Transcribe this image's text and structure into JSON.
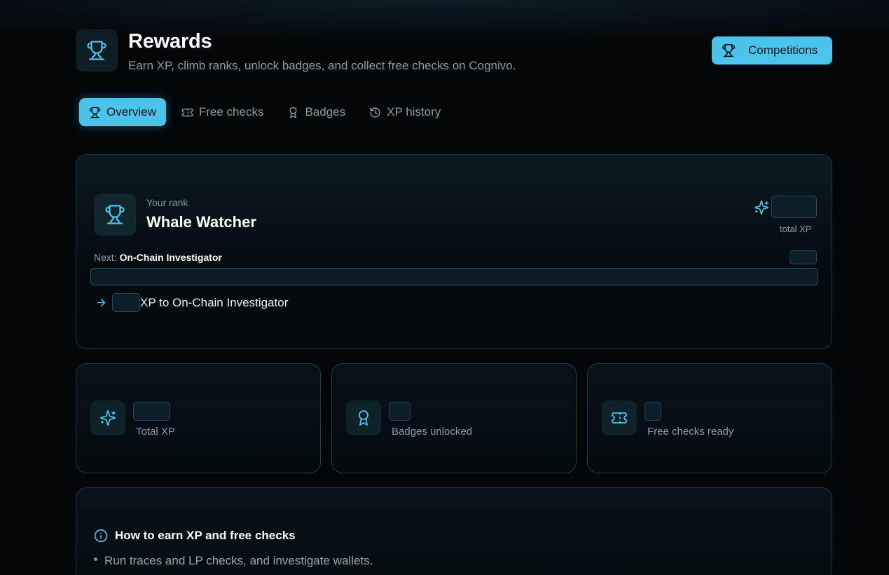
{
  "colors": {
    "accent": "#4cc3ea",
    "background": "#03070a",
    "card_border": "#1d3a45"
  },
  "header": {
    "icon": "trophy-icon",
    "title": "Rewards",
    "subtitle": "Earn XP, climb ranks, unlock badges, and collect free checks on Cognivo.",
    "competitions_label": "Competitions"
  },
  "tabs": [
    {
      "label": "Overview",
      "icon": "trophy-icon",
      "active": true
    },
    {
      "label": "Free checks",
      "icon": "ticket-icon",
      "active": false
    },
    {
      "label": "Badges",
      "icon": "award-icon",
      "active": false
    },
    {
      "label": "XP history",
      "icon": "history-icon",
      "active": false
    }
  ],
  "rank": {
    "label": "Your rank",
    "name": "Whale Watcher",
    "total_xp_label": "total XP",
    "next_prefix": "Next:",
    "next_name": "On-Chain Investigator",
    "to_next_suffix": "XP to On-Chain Investigator"
  },
  "stats": [
    {
      "label": "Total XP",
      "icon": "sparkles-icon"
    },
    {
      "label": "Badges unlocked",
      "icon": "award-icon"
    },
    {
      "label": "Free checks ready",
      "icon": "ticket-icon"
    }
  ],
  "info": {
    "title": "How to earn XP and free checks",
    "items": [
      "Run traces and LP checks, and investigate wallets."
    ]
  }
}
